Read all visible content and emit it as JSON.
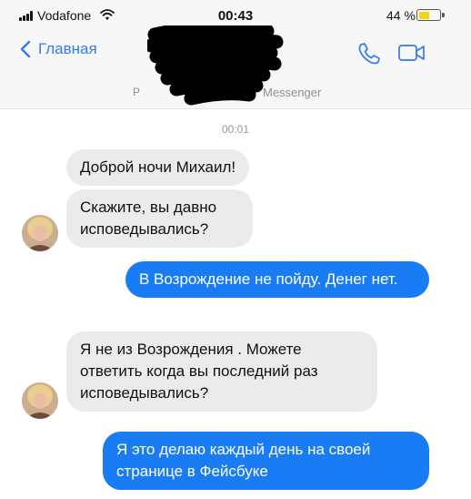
{
  "status_bar": {
    "carrier": "Vodafone",
    "time": "00:43",
    "battery_percent": "44 %",
    "battery_level": 0.44
  },
  "nav": {
    "back_label": "Главная",
    "accent_color": "#3478f6"
  },
  "info_strip": {
    "left_fragment": "Р",
    "right_text": "Messenger"
  },
  "conversation": {
    "timestamp": "00:01",
    "messages": [
      {
        "direction": "incoming",
        "text": "Доброй ночи Михаил!"
      },
      {
        "direction": "incoming",
        "text": "Скажите, вы давно исповедывались?"
      },
      {
        "direction": "outgoing",
        "text": "В Возрождение не пойду. Денег нет."
      },
      {
        "direction": "incoming",
        "text": "Я не из Возрождения . Можете ответить когда вы последний раз исповедывались?"
      },
      {
        "direction": "outgoing",
        "text": "Я это делаю каждый день на своей странице в Фейсбуке"
      }
    ]
  },
  "colors": {
    "incoming_bubble": "#ebebeb",
    "outgoing_bubble": "#1a7cf4",
    "header_background": "#f7f7f7"
  },
  "icons": [
    "signal-bars-icon",
    "wifi-icon",
    "battery-icon",
    "chevron-left-icon",
    "phone-icon",
    "video-camera-icon"
  ]
}
